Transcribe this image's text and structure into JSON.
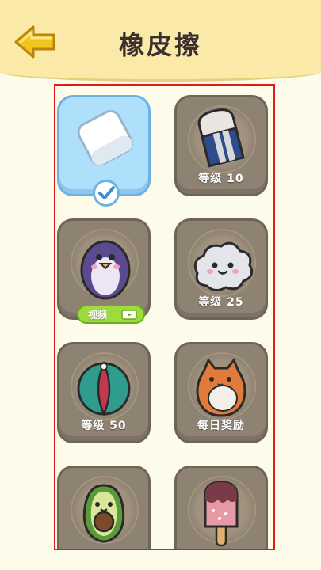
{
  "header": {
    "title": "橡皮擦",
    "back_icon": "back-arrow-icon"
  },
  "colors": {
    "header_bg": "#fbe9a8",
    "page_bg": "#fdfbea",
    "selected_card": "#aee0fb",
    "locked_card": "#8e8273",
    "frame": "#e11b1b",
    "video_button": "#9edb3c"
  },
  "items": [
    {
      "name": "white-eraser",
      "selected": true,
      "label": ""
    },
    {
      "name": "striped-eraser",
      "label": "等级 10"
    },
    {
      "name": "penguin-eraser",
      "label": "",
      "video_button": {
        "text": "视频",
        "icon": "video-play-icon"
      }
    },
    {
      "name": "cloud-eraser",
      "label": "等级 25"
    },
    {
      "name": "ball-eraser",
      "label": "等级 50"
    },
    {
      "name": "cat-eraser",
      "label": "每日奖励"
    },
    {
      "name": "avocado-eraser",
      "label": ""
    },
    {
      "name": "popsicle-eraser",
      "label": ""
    }
  ]
}
